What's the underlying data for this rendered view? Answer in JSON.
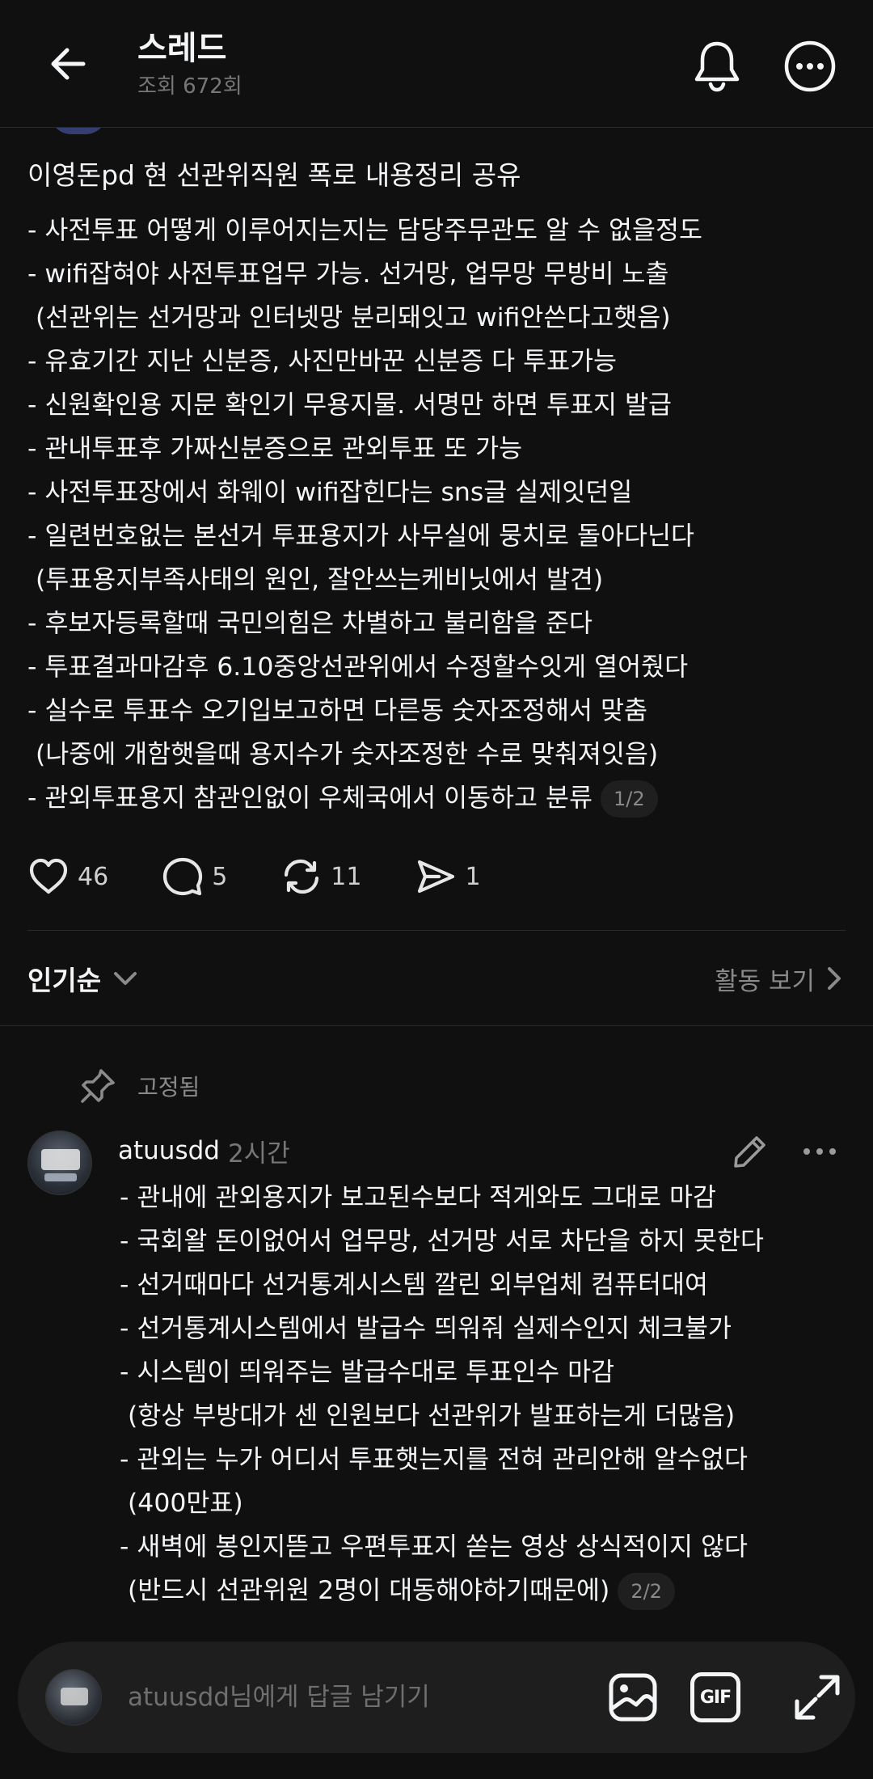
{
  "header": {
    "title": "스레드",
    "views": "조회 672회"
  },
  "post": {
    "title": "이영돈pd 현 선관위직원 폭로 내용정리 공유",
    "lines": [
      "- 사전투표 어떻게 이루어지는지는 담당주무관도 알 수 없을정도",
      "- wifi잡혀야 사전투표업무 가능. 선거망, 업무망 무방비 노출",
      "(선관위는 선거망과 인터넷망 분리돼잇고 wifi안쓴다고햇음)",
      "- 유효기간 지난 신분증, 사진만바꾼 신분증 다 투표가능",
      "- 신원확인용 지문 확인기 무용지물. 서명만 하면 투표지 발급",
      "- 관내투표후 가짜신분증으로 관외투표 또 가능",
      "- 사전투표장에서 화웨이 wifi잡힌다는 sns글 실제잇던일",
      "- 일련번호없는 본선거 투표용지가 사무실에 뭉치로 돌아다닌다",
      "(투표용지부족사태의 원인, 잘안쓰는케비닛에서 발견)",
      "- 후보자등록할때 국민의힘은 차별하고 불리함을 준다",
      "- 투표결과마감후 6.10중앙선관위에서 수정할수잇게 열어줬다",
      "- 실수로 투표수 오기입보고하면 다른동 숫자조정해서 맞춤",
      "(나중에 개함햇을때 용지수가 숫자조정한 수로 맞춰져잇음)",
      "- 관외투표용지 참관인없이 우체국에서 이동하고 분류"
    ],
    "page_indicator": "1/2"
  },
  "actions": {
    "likes": "46",
    "comments": "5",
    "reposts": "11",
    "shares": "1"
  },
  "sort": {
    "label": "인기순",
    "activity_label": "활동 보기"
  },
  "pinned_label": "고정됨",
  "reply": {
    "username": "atuusdd",
    "time": "2시간",
    "lines": [
      "- 관내에 관외용지가 보고된수보다 적게와도 그대로 마감",
      "- 국회왈 돈이없어서 업무망, 선거망 서로 차단을 하지 못한다",
      "- 선거때마다 선거통계시스템 깔린 외부업체 컴퓨터대여",
      "- 선거통계시스템에서 발급수 띄워줘 실제수인지 체크불가",
      "- 시스템이 띄워주는 발급수대로 투표인수 마감",
      "(항상 부방대가 센 인원보다 선관위가 발표하는게 더많음)",
      "- 관외는 누가 어디서 투표햇는지를 전혀 관리안해 알수없다",
      "(400만표)",
      "- 새벽에 봉인지뜯고 우편투표지 쏟는 영상 상식적이지 않다",
      "(반드시 선관위원 2명이 대동해야하기때문에)"
    ],
    "page_indicator": "2/2"
  },
  "composer": {
    "placeholder": "atuusdd님에게 답글 남기기",
    "gif_label": "GIF"
  },
  "colors": {
    "background": "#101010",
    "text": "#f3f5f7",
    "muted": "#8a8a8a",
    "pill": "#1f1f1f",
    "composer": "#1e1e1e"
  }
}
